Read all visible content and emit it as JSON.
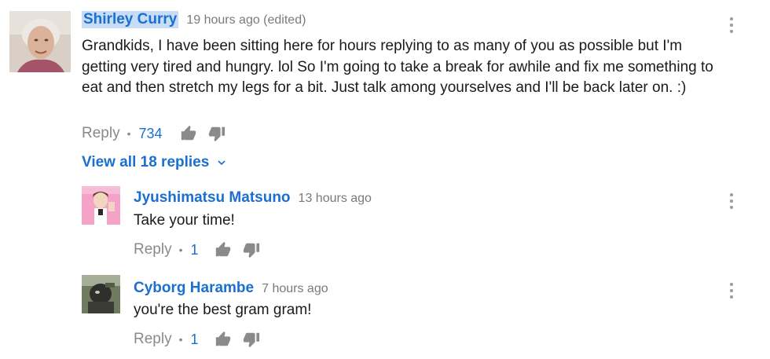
{
  "comments": [
    {
      "author": "Shirley Curry",
      "time": "19 hours ago (edited)",
      "text": "Grandkids, I have been sitting here for hours replying to as many of you as possible but I'm getting very tired and hungry. lol  So I'm going to take a break for awhile and fix me something to eat and then stretch my legs for a bit. Just talk among yourselves and I'll be back later on. :)",
      "reply_label": "Reply",
      "likes": "734"
    }
  ],
  "view_replies": "View all 18 replies",
  "replies": [
    {
      "author": "Jyushimatsu Matsuno",
      "time": "13 hours ago",
      "text": "Take your time!",
      "reply_label": "Reply",
      "likes": "1"
    },
    {
      "author": "Cyborg Harambe",
      "time": "7 hours ago",
      "text": "you're the best gram gram!",
      "reply_label": "Reply",
      "likes": "1"
    }
  ],
  "icons": {
    "like": "thumbs-up-icon",
    "dislike": "thumbs-down-icon",
    "menu": "more-vertical-icon",
    "chevron": "chevron-down-icon"
  },
  "colors": {
    "author_link": "#1a6fcf",
    "author_highlight": "#c7ddf5",
    "muted_text": "#8a8a8a"
  }
}
